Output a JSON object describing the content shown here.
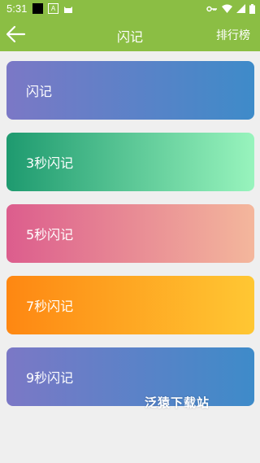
{
  "status_bar": {
    "time": "5:31",
    "a_icon": "A",
    "icons": [
      "black-square-icon",
      "a-box-icon",
      "cat-icon",
      "key-icon",
      "wifi-icon",
      "signal-icon",
      "battery-icon"
    ]
  },
  "app_bar": {
    "back_icon": "back-arrow-icon",
    "title": "闪记",
    "rank_label": "排行榜"
  },
  "cards": [
    {
      "label": "闪记"
    },
    {
      "label": "3秒闪记"
    },
    {
      "label": "5秒闪记"
    },
    {
      "label": "7秒闪记"
    },
    {
      "label": "9秒闪记"
    }
  ],
  "colors": {
    "header": "#8bbe44",
    "background": "#efefef"
  },
  "watermark": "泛猿下载站"
}
